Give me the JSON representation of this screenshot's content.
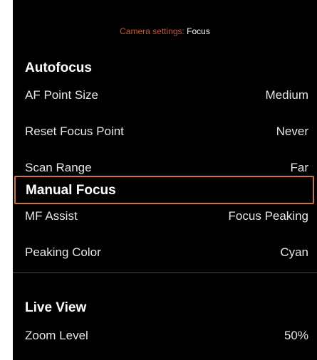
{
  "header": {
    "parent": "Camera settings:",
    "current": "Focus"
  },
  "sections": {
    "autofocus": {
      "title": "Autofocus",
      "rows": [
        {
          "label": "AF Point Size",
          "value": "Medium"
        },
        {
          "label": "Reset Focus Point",
          "value": "Never"
        },
        {
          "label": "Scan Range",
          "value": "Far"
        }
      ]
    },
    "manual_focus": {
      "title": "Manual Focus",
      "rows": [
        {
          "label": "MF Assist",
          "value": "Focus Peaking"
        },
        {
          "label": "Peaking Color",
          "value": "Cyan"
        }
      ]
    },
    "live_view": {
      "title": "Live View",
      "rows": [
        {
          "label": "Zoom Level",
          "value": "50%"
        }
      ]
    }
  },
  "colors": {
    "background": "#000000",
    "breadcrumb_parent": "#c4562a",
    "focus_highlight": "#c8753e",
    "text": "#ffffff"
  }
}
